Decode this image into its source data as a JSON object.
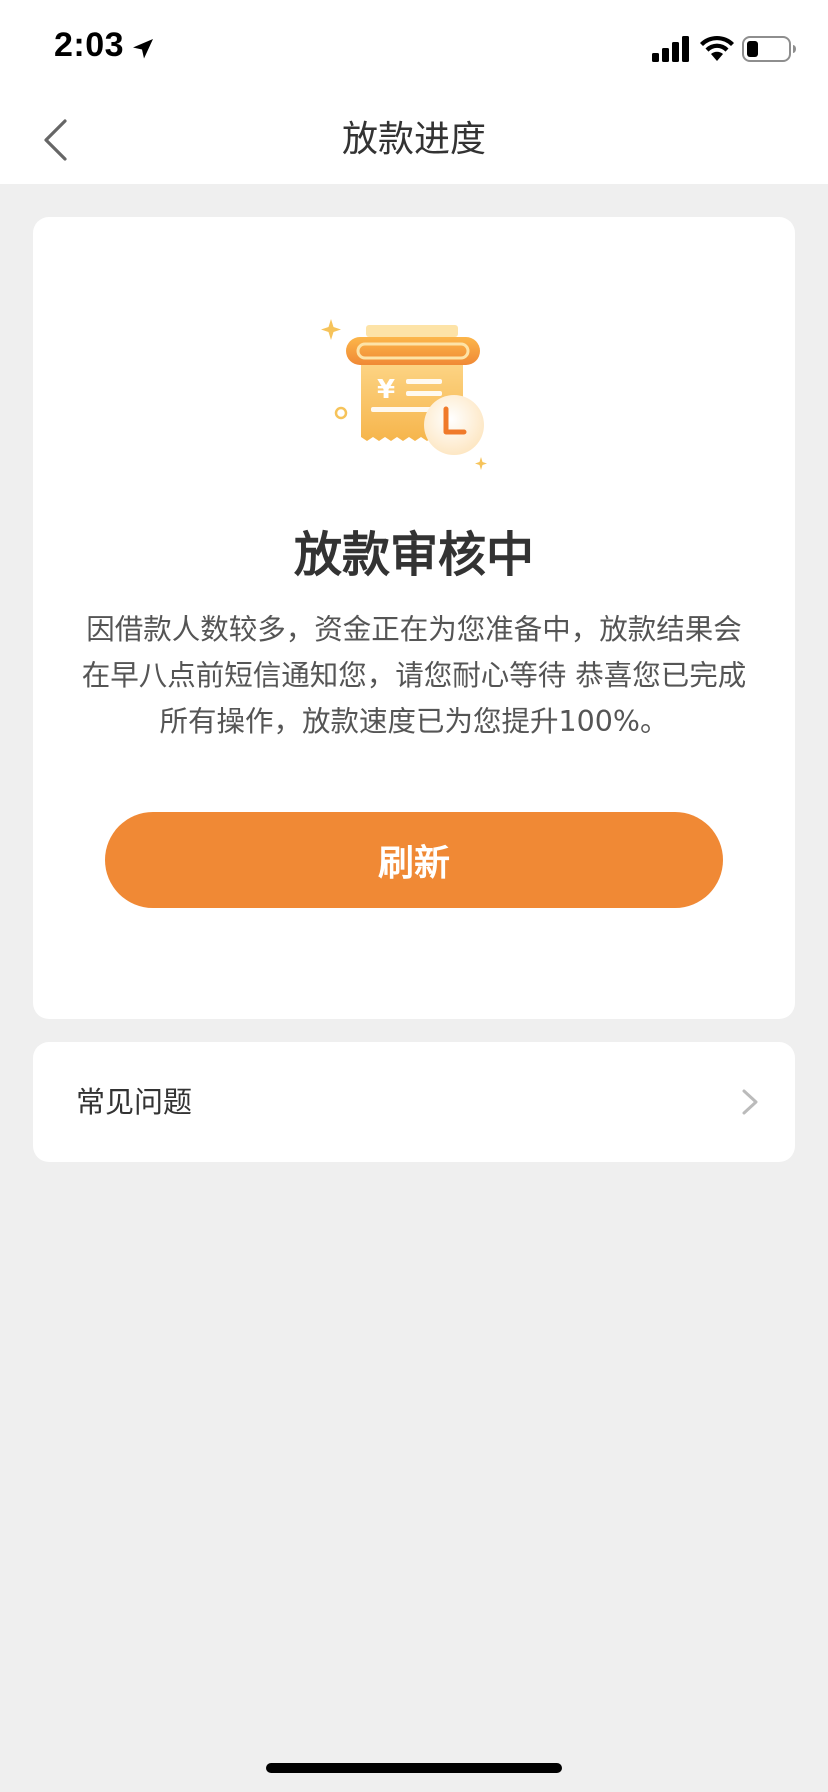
{
  "status_bar": {
    "time": "2:03",
    "icons": [
      "location-arrow-icon",
      "cellular-signal-icon",
      "wifi-icon",
      "battery-icon"
    ]
  },
  "nav": {
    "back_icon": "chevron-left-icon",
    "title": "放款进度"
  },
  "main_card": {
    "illustration": "receipt-clock-icon",
    "illustration_symbol": "¥",
    "status_title": "放款审核中",
    "description": "因借款人数较多，资金正在为您准备中，放款结果会在早八点前短信通知您，请您耐心等待 恭喜您已完成所有操作，放款速度已为您提升100%。",
    "refresh_label": "刷新"
  },
  "faq": {
    "label": "常见问题",
    "chevron_icon": "chevron-right-icon"
  },
  "colors": {
    "accent": "#f08935",
    "background": "#efefef",
    "card": "#ffffff",
    "title_text": "#333333",
    "body_text": "#555555"
  }
}
